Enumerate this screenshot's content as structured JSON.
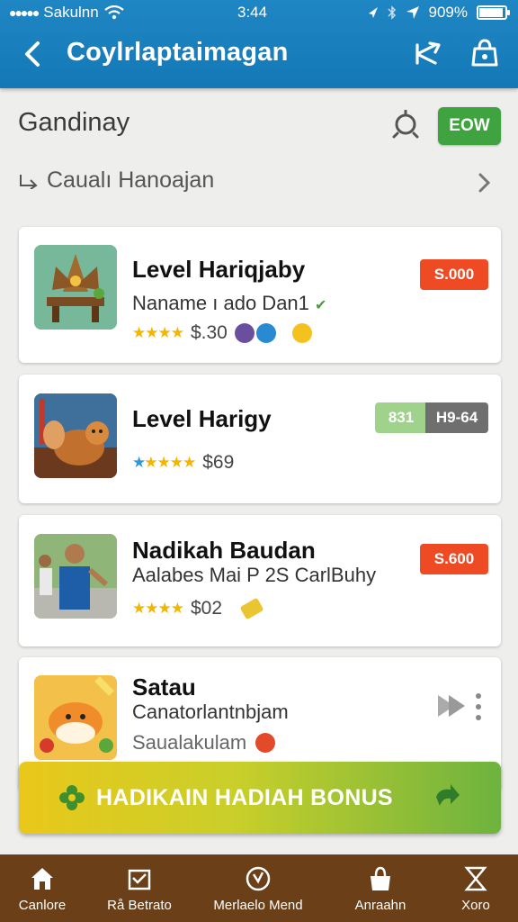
{
  "status_bar": {
    "carrier": "Sakulnn",
    "time": "3:44",
    "battery": "909%"
  },
  "app_bar": {
    "title": "Coylrlaptaimagan"
  },
  "header": {
    "section_title": "Gandinay",
    "now_button": "EOW",
    "breadcrumb": "Caualı Hanoajan"
  },
  "cards": [
    {
      "title": "Level Hariqjaby",
      "subtitle": "Naname ı ado Dan1",
      "rating": "★★★★",
      "price": "$.30",
      "badge": "S.000"
    },
    {
      "title": "Level Harigy",
      "subtitle": "",
      "rating": "★★★★",
      "price": "$69",
      "badge_left": "831",
      "badge_right": "H9-64"
    },
    {
      "title": "Nadikah Baudan",
      "subtitle": "Aalabes Mai P 2S CarlBuhy",
      "rating": "★★★★",
      "price": "$02",
      "badge": "S.600"
    },
    {
      "title": "Satau",
      "subtitle": "Canatorlantnbjam",
      "extra": "Saualakulam"
    }
  ],
  "bonus": {
    "label": "HADIKAIN HADIAH BONUS"
  },
  "bottom_nav": [
    {
      "label": "Canlore",
      "icon": "home-icon"
    },
    {
      "label": "Rå Betrato",
      "icon": "gift-icon"
    },
    {
      "label": "Merlaelo Mend",
      "icon": "compass-icon"
    },
    {
      "label": "Anraahn",
      "icon": "bag-icon"
    },
    {
      "label": "Xoro",
      "icon": "hourglass-icon"
    }
  ],
  "colors": {
    "app_bar": "#1f86c4",
    "now_button": "#3fa33f",
    "badge_red": "#ee4a23",
    "bottom_nav": "#6b3f17"
  }
}
